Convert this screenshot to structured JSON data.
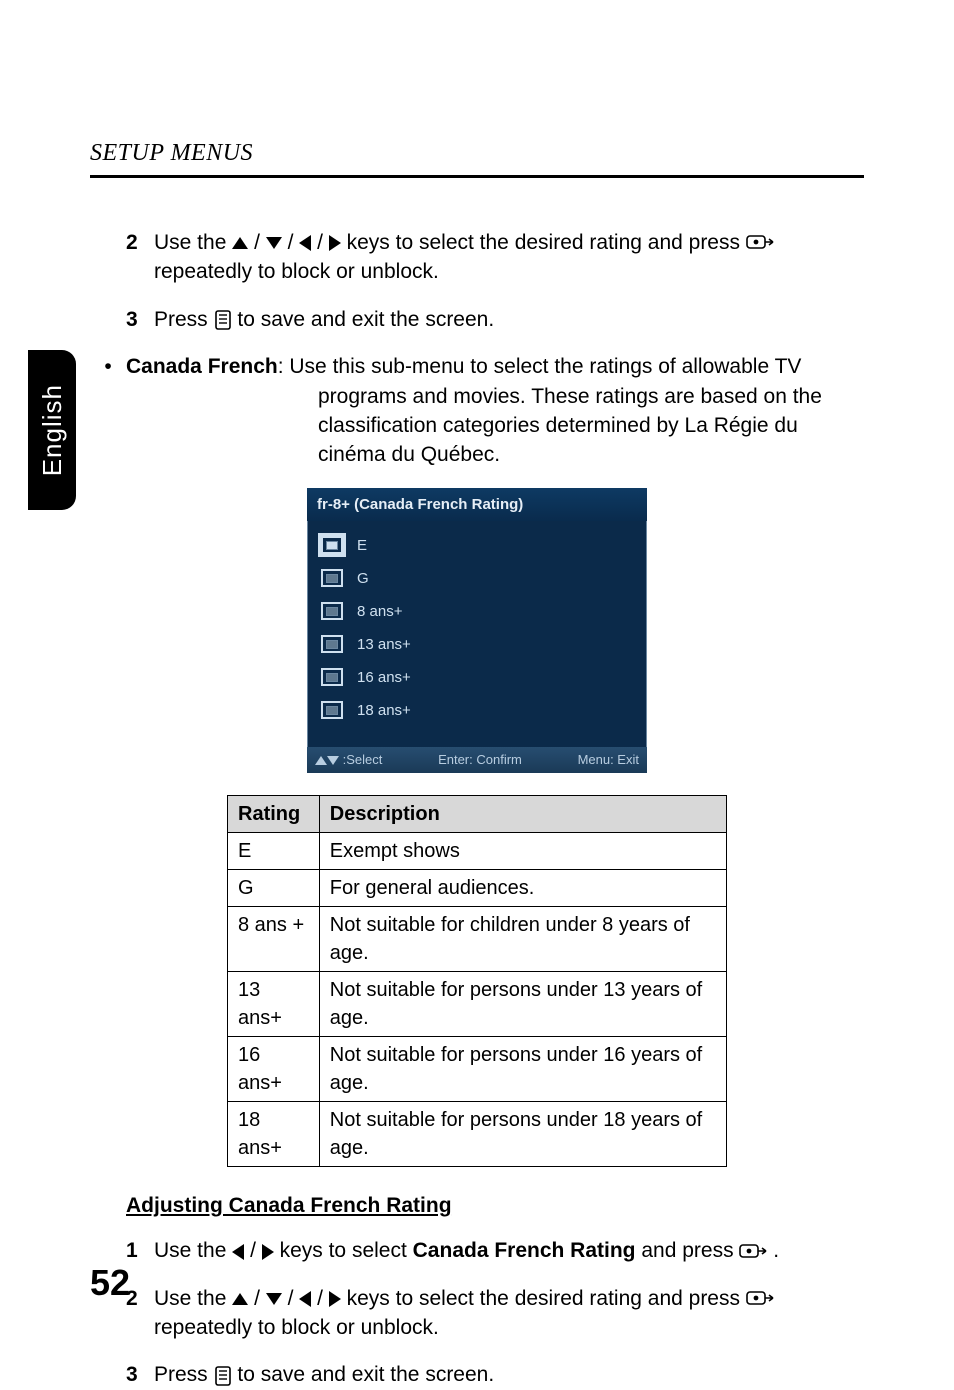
{
  "header": {
    "section_title": "SETUP MENUS"
  },
  "side_tab": {
    "label": "English"
  },
  "steps_a": [
    {
      "num": "2",
      "pre": "Use the ",
      "post": " keys to select the desired rating and press ",
      "tail": " repeatedly to block or unblock."
    },
    {
      "num": "3",
      "pre": "Press ",
      "post": " to save and exit the screen."
    }
  ],
  "bullet": {
    "label": "Canada French",
    "sep": ": ",
    "text": "Use this sub-menu to select the ratings of allowable TV programs and movies. These ratings are based on the classification categories determined by La Régie du cinéma du Québec."
  },
  "screenshot": {
    "title": "fr-8+ (Canada French Rating)",
    "rows": [
      "E",
      "G",
      "8 ans+",
      "13 ans+",
      "16 ans+",
      "18 ans+"
    ],
    "footer": {
      "select": ":Select",
      "confirm": "Enter: Confirm",
      "exit": "Menu: Exit"
    }
  },
  "table": {
    "headers": [
      "Rating",
      "Description"
    ],
    "rows": [
      [
        "E",
        "Exempt shows"
      ],
      [
        "G",
        "For general audiences."
      ],
      [
        "8 ans +",
        "Not suitable for children under 8 years of age."
      ],
      [
        "13 ans+",
        "Not suitable for persons under 13 years of age."
      ],
      [
        "16 ans+",
        "Not suitable for persons under 16 years of age."
      ],
      [
        "18 ans+",
        "Not suitable for persons under 18 years of age."
      ]
    ]
  },
  "subhead": "Adjusting Canada French Rating",
  "steps_b": [
    {
      "num": "1",
      "pre": "Use the ",
      "mid": " keys to select ",
      "bold": "Canada French Rating",
      "post": " and press ",
      "tail": "."
    },
    {
      "num": "2",
      "pre": "Use the ",
      "post": " keys to select the desired rating and press ",
      "tail": " repeatedly to block or unblock."
    },
    {
      "num": "3",
      "pre": "Press ",
      "post": " to save and exit the screen."
    }
  ],
  "page_number": "52",
  "glyph_sep": " / "
}
